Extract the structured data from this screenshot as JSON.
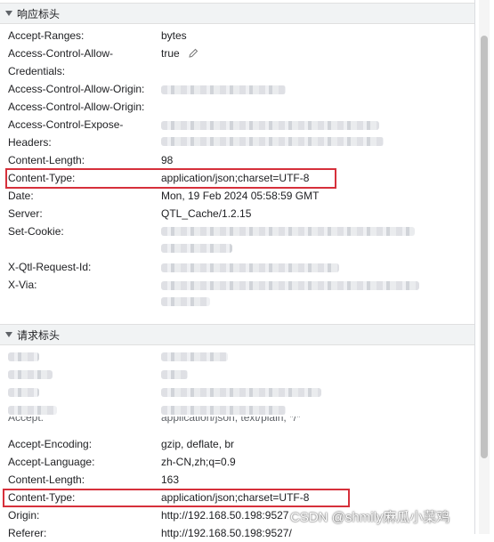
{
  "response_section": {
    "title": "响应标头"
  },
  "response_headers": [
    {
      "key": "Accept-Ranges:",
      "value": "bytes"
    },
    {
      "key": "Access-Control-Allow-",
      "value": "true"
    },
    {
      "key": "Credentials:",
      "value": ""
    },
    {
      "key": "Access-Control-Allow-Origin:",
      "value": ""
    },
    {
      "key": "Access-Control-Allow-Origin:",
      "value": ""
    },
    {
      "key": "Access-Control-Expose-",
      "value": ""
    },
    {
      "key": "Headers:",
      "value": ""
    },
    {
      "key": "Content-Length:",
      "value": "98"
    },
    {
      "key": "Content-Type:",
      "value": "application/json;charset=UTF-8"
    },
    {
      "key": "Date:",
      "value": "Mon, 19 Feb 2024 05:58:59 GMT"
    },
    {
      "key": "Server:",
      "value": "QTL_Cache/1.2.15"
    },
    {
      "key": "Set-Cookie:",
      "value": ""
    },
    {
      "key": "",
      "value": ""
    },
    {
      "key": "X-Qtl-Request-Id:",
      "value": ""
    },
    {
      "key": "X-Via:",
      "value": ""
    }
  ],
  "request_section": {
    "title": "请求标头"
  },
  "request_headers": [
    {
      "key": "Accept-Encoding:",
      "value": "gzip, deflate, br"
    },
    {
      "key": "Accept-Language:",
      "value": "zh-CN,zh;q=0.9"
    },
    {
      "key": "Content-Length:",
      "value": "163"
    },
    {
      "key": "Content-Type:",
      "value": "application/json;charset=UTF-8"
    },
    {
      "key": "Origin:",
      "value": "http://192.168.50.198:9527"
    },
    {
      "key": "Referer:",
      "value": "http://192.168.50.198:9527/"
    }
  ],
  "partial_row": {
    "key": "Accept:",
    "value": "application/json, text/plain, */*"
  },
  "watermark": "CSDN @shmily麻瓜小菜鸡",
  "colors": {
    "highlight": "#d6303b",
    "header_bg": "#f1f3f4"
  }
}
